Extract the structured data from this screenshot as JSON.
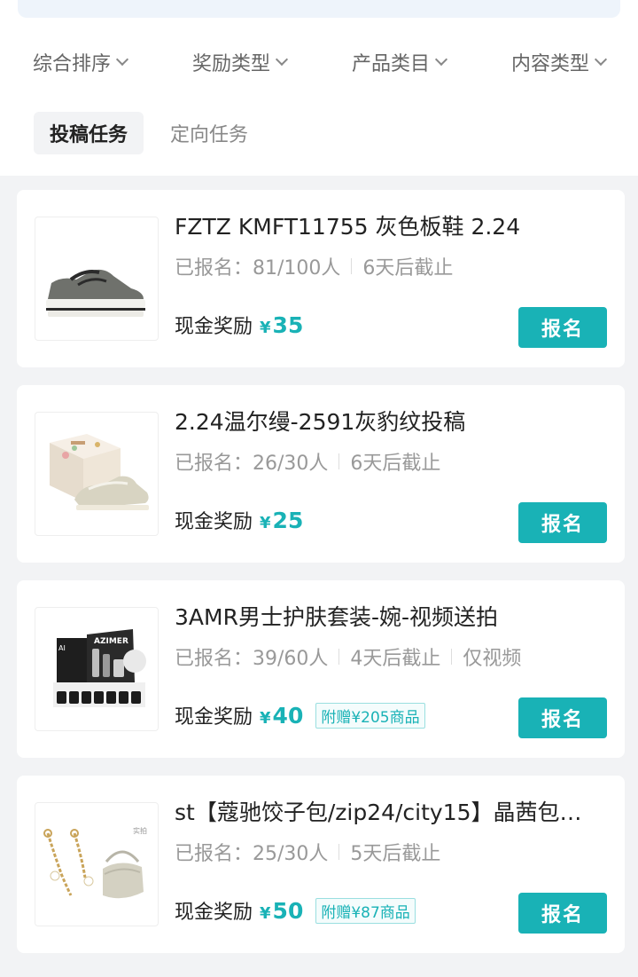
{
  "filters": [
    {
      "label": "综合排序"
    },
    {
      "label": "奖励类型"
    },
    {
      "label": "产品类目"
    },
    {
      "label": "内容类型"
    }
  ],
  "tabs": {
    "active": "投稿任务",
    "inactive": "定向任务"
  },
  "tasks": [
    {
      "title": "FZTZ KMFT11755 灰色板鞋 2.24",
      "registered": "已报名：81/100人",
      "deadline": "6天后截止",
      "reward_label": "现金奖励",
      "currency": "¥",
      "amount": "35",
      "button": "报名",
      "image": "gray-sneaker"
    },
    {
      "title": "2.24温尔缦-2591灰豹纹投稿",
      "registered": "已报名：26/30人",
      "deadline": "6天后截止",
      "reward_label": "现金奖励",
      "currency": "¥",
      "amount": "25",
      "button": "报名",
      "image": "sneaker-with-box"
    },
    {
      "title": "3AMR男士护肤套装-婉-视频送拍",
      "registered": "已报名：39/60人",
      "deadline": "4天后截止",
      "extra": "仅视频",
      "reward_label": "现金奖励",
      "currency": "¥",
      "amount": "40",
      "bonus": "附赠¥205商品",
      "button": "报名",
      "image": "skincare-set",
      "image_text": "AZIMER"
    },
    {
      "title": "st【蔻驰饺子包/zip24/city15】晶茜包…",
      "registered": "已报名：25/30人",
      "deadline": "5天后截止",
      "reward_label": "现金奖励",
      "currency": "¥",
      "amount": "50",
      "bonus": "附赠¥87商品",
      "button": "报名",
      "image": "handbag-with-chain",
      "image_text": "实拍"
    }
  ],
  "colors": {
    "accent": "#19b2b6",
    "page_bg": "#f2f3f5"
  }
}
